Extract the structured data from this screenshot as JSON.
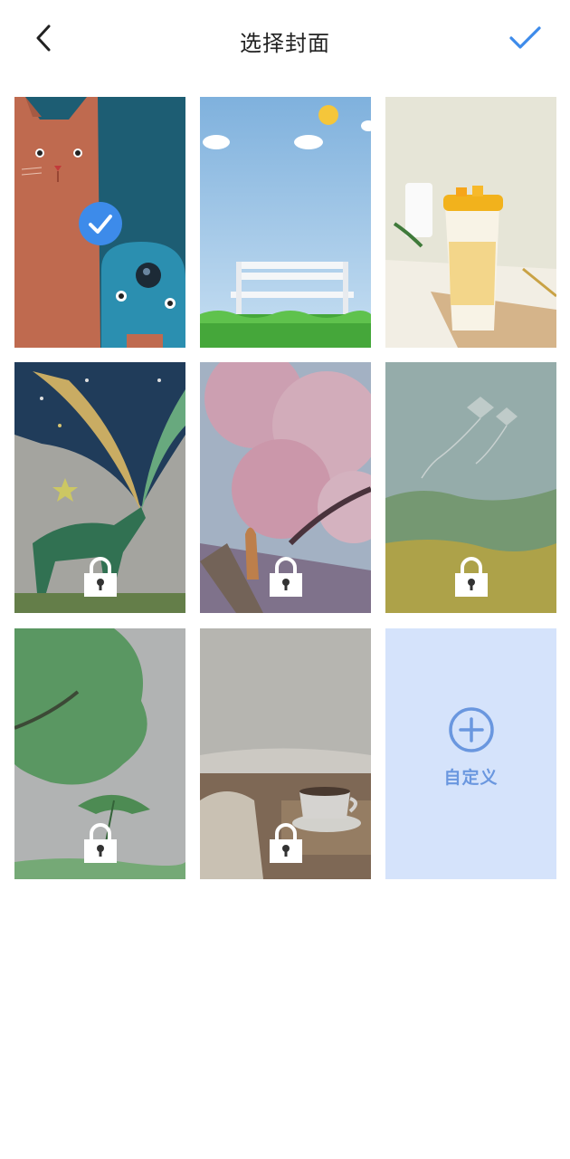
{
  "header": {
    "title": "选择封面",
    "back_icon": "chevron-left-icon",
    "confirm_icon": "checkmark-icon",
    "accent_color": "#3d8bea"
  },
  "covers": [
    {
      "theme": "cat-and-koala",
      "selected": true,
      "locked": false
    },
    {
      "theme": "park-bench-sky",
      "selected": false,
      "locked": false
    },
    {
      "theme": "mango-drink",
      "selected": false,
      "locked": false
    },
    {
      "theme": "starry-deer",
      "selected": false,
      "locked": true
    },
    {
      "theme": "cherry-blossom-cat",
      "selected": false,
      "locked": true
    },
    {
      "theme": "kites-meadow",
      "selected": false,
      "locked": true
    },
    {
      "theme": "rain-tree-umbrella",
      "selected": false,
      "locked": true
    },
    {
      "theme": "coffee-window",
      "selected": false,
      "locked": true
    }
  ],
  "custom": {
    "label": "自定义",
    "icon": "plus-circle-icon",
    "background": "#d5e3fb",
    "color": "#6a97df"
  }
}
